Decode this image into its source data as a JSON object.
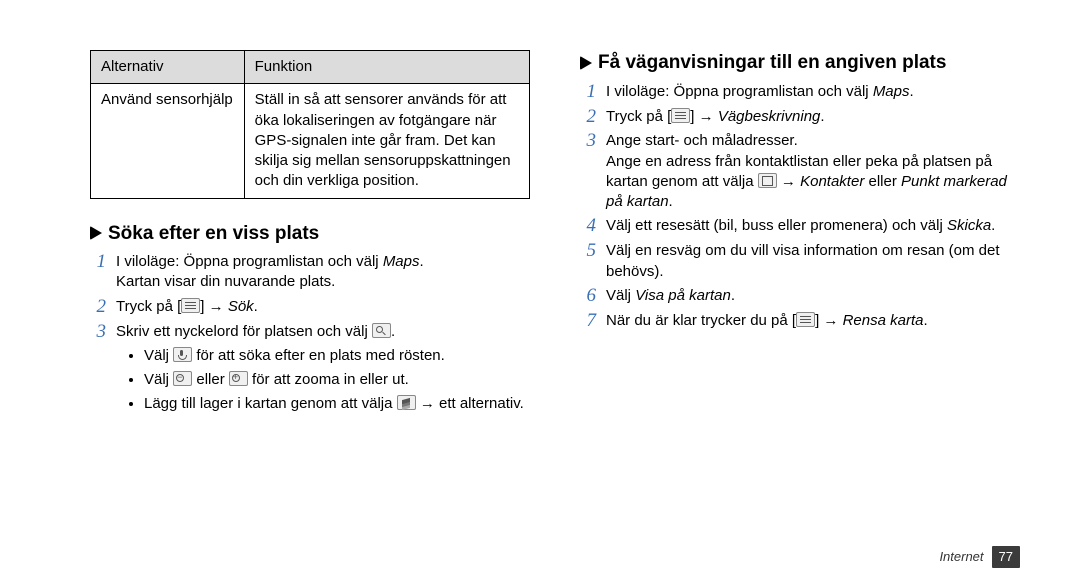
{
  "table": {
    "header_left": "Alternativ",
    "header_right": "Funktion",
    "row_left": "Använd sensorhjälp",
    "row_right": "Ställ in så att sensorer används för att öka lokaliseringen av fotgängare när GPS-signalen inte går fram. Det kan skilja sig mellan sensoruppskattningen och din verkliga position."
  },
  "left": {
    "heading": "Söka efter en viss plats",
    "step1a": "I viloläge: Öppna programlistan och välj ",
    "step1b": "Maps",
    "step1c": ".",
    "step1_sub": "Kartan visar din nuvarande plats.",
    "step2a": "Tryck på [",
    "step2b": "] → ",
    "step2c": "Sök",
    "step2d": ".",
    "step3a": "Skriv ett nyckelord för platsen och välj ",
    "step3b": ".",
    "bullet1a": "Välj ",
    "bullet1b": " för att söka efter en plats med rösten.",
    "bullet2a": "Välj ",
    "bullet2b": " eller ",
    "bullet2c": " för att zooma in eller ut.",
    "bullet3a": "Lägg till lager i kartan genom att välja ",
    "bullet3b": " → ett alternativ."
  },
  "right": {
    "heading": "Få väganvisningar till en angiven plats",
    "step1a": "I viloläge: Öppna programlistan och välj ",
    "step1b": "Maps",
    "step1c": ".",
    "step2a": "Tryck på [",
    "step2b": "] → ",
    "step2c": "Vägbeskrivning",
    "step2d": ".",
    "step3": "Ange start- och måladresser.",
    "step3_sub_a": "Ange en adress från kontaktlistan eller peka på platsen på kartan genom att välja ",
    "step3_sub_b": " → ",
    "step3_sub_c": "Kontakter",
    "step3_sub_d": " eller ",
    "step3_sub_e": "Punkt markerad på kartan",
    "step3_sub_f": ".",
    "step4a": "Välj ett resesätt (bil, buss eller promenera) och välj ",
    "step4b": "Skicka",
    "step4c": ".",
    "step5": "Välj en resväg om du vill visa information om resan (om det behövs).",
    "step6a": "Välj ",
    "step6b": "Visa på kartan",
    "step6c": ".",
    "step7a": "När du är klar trycker du på [",
    "step7b": "] → ",
    "step7c": "Rensa karta",
    "step7d": "."
  },
  "footer": {
    "section": "Internet",
    "page": "77"
  },
  "nums": {
    "n1": "1",
    "n2": "2",
    "n3": "3",
    "n4": "4",
    "n5": "5",
    "n6": "6",
    "n7": "7"
  }
}
